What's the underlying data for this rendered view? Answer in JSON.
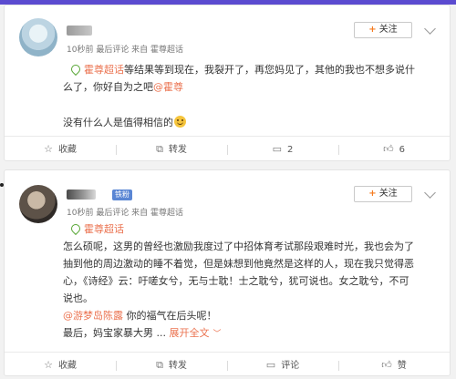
{
  "posts": [
    {
      "meta": "10秒前  最后评论  来自 霍尊超话",
      "follow": "关注",
      "topic": "霍尊超话",
      "line1_rest": "等结果等到现在，我裂开了，再您妈见了，其他的我也不想多说什",
      "line2_prefix": "么了，你好自为之吧",
      "line2_mention": "@霍尊",
      "line3": "没有什么人是值得相信的",
      "actions": {
        "collect": "收藏",
        "repost": "转发",
        "comment": "2",
        "like": "6"
      }
    },
    {
      "meta": "10秒前  最后评论  来自 霍尊超话",
      "badge": "铁粉",
      "follow": "关注",
      "topic": "霍尊超话",
      "body_lines": [
        "怎么硕呢，这男的曾经也激励我度过了中招体育考试那段艰难时光，我也会为了",
        "抽到他的周边激动的睡不着觉，但是妹想到他竟然是这样的人，现在我只觉得恶",
        "心，《诗经》云：吁嗟女兮，无与士耽！士之耽兮，犹可说也。女之耽兮，不可",
        "说也。"
      ],
      "mention": "@游梦岛陈露",
      "mention_rest": "你的福气在后头呢！",
      "last_line": "最后，妈宝家暴大男 ...",
      "expand": "展开全文",
      "actions": {
        "collect": "收藏",
        "repost": "转发",
        "comment": "评论",
        "like": "赞"
      }
    }
  ]
}
